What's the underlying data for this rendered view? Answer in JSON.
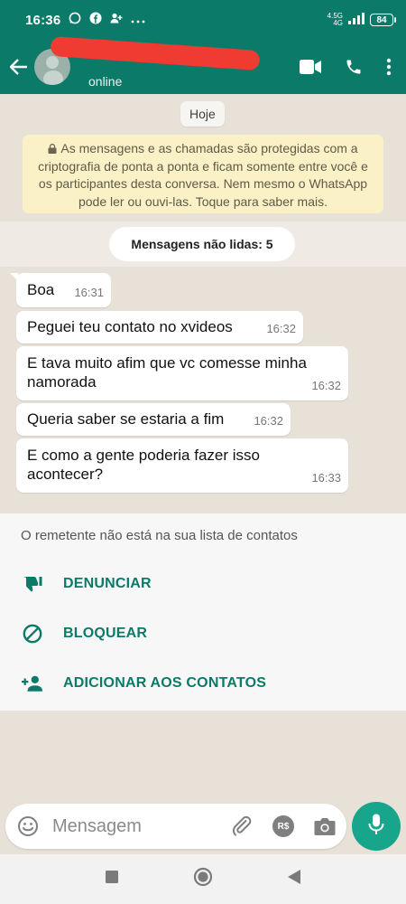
{
  "colors": {
    "header": "#0b7a68",
    "accent": "#17a58b",
    "chat_bg": "#e8e1d8",
    "encryption_bg": "#fbf1c7"
  },
  "status_bar": {
    "time": "16:36",
    "network_top": "4.5G",
    "network_bottom": "4G",
    "battery": "84"
  },
  "header": {
    "contact_status": "online",
    "icons": [
      "back-arrow-icon",
      "avatar",
      "video-call-icon",
      "phone-icon",
      "more-vert-icon"
    ]
  },
  "chat": {
    "date_label": "Hoje",
    "encryption_notice": "As mensagens e as chamadas são protegidas com a criptografia de ponta a ponta e ficam somente entre você e os participantes desta conversa. Nem mesmo o WhatsApp pode ler ou ouvi-las. Toque para saber mais.",
    "unread_label": "Mensagens não lidas: 5",
    "messages": [
      {
        "text": "Boa",
        "time": "16:31"
      },
      {
        "text": "Peguei teu contato no xvideos",
        "time": "16:32"
      },
      {
        "text": "E tava muito afim que vc comesse minha namorada",
        "time": "16:32"
      },
      {
        "text": "Queria saber se estaria a fim",
        "time": "16:32"
      },
      {
        "text": "E como a gente poderia fazer isso acontecer?",
        "time": "16:33"
      }
    ]
  },
  "unknown_sender": {
    "notice": "O remetente não está na sua lista de contatos",
    "actions": [
      {
        "label": "DENUNCIAR",
        "icon": "thumb-down-icon"
      },
      {
        "label": "BLOQUEAR",
        "icon": "block-icon"
      },
      {
        "label": "ADICIONAR AOS CONTATOS",
        "icon": "add-person-icon"
      }
    ]
  },
  "composer": {
    "placeholder": "Mensagem",
    "payment_label": "R$",
    "icons": [
      "emoji-icon",
      "attach-icon",
      "payment-icon",
      "camera-icon",
      "mic-icon"
    ]
  },
  "nav_bar": {
    "icons": [
      "recents-square-icon",
      "home-circle-icon",
      "back-triangle-icon"
    ]
  }
}
